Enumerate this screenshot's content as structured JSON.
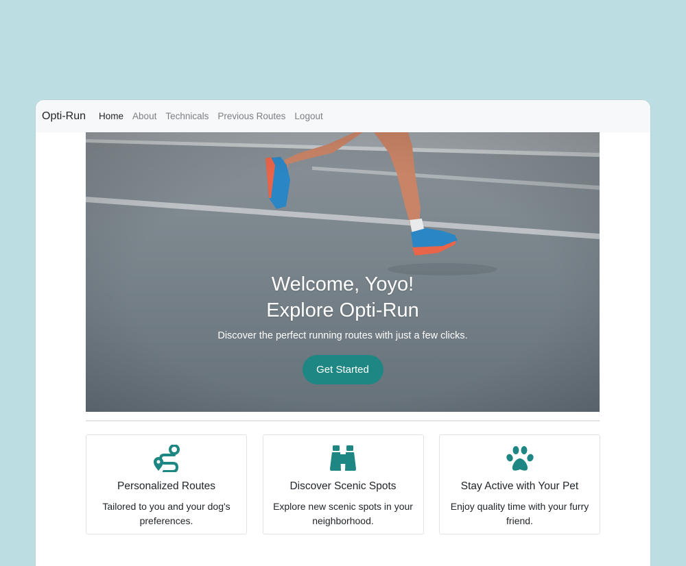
{
  "nav": {
    "brand": "Opti-Run",
    "links": [
      {
        "label": "Home",
        "active": true
      },
      {
        "label": "About",
        "active": false
      },
      {
        "label": "Technicals",
        "active": false
      },
      {
        "label": "Previous Routes",
        "active": false
      },
      {
        "label": "Logout",
        "active": false
      }
    ]
  },
  "hero": {
    "title_line1": "Welcome, Yoyo!",
    "title_line2": "Explore Opti-Run",
    "subtitle": "Discover the perfect running routes with just a few clicks.",
    "cta_label": "Get Started"
  },
  "features": [
    {
      "icon": "route-icon",
      "title": "Personalized Routes",
      "description": "Tailored to you and your dog's preferences."
    },
    {
      "icon": "binoculars-icon",
      "title": "Discover Scenic Spots",
      "description": "Explore new scenic spots in your neighborhood."
    },
    {
      "icon": "paw-icon",
      "title": "Stay Active with Your Pet",
      "description": "Enjoy quality time with your furry friend."
    }
  ],
  "colors": {
    "page_background": "#bcdde2",
    "accent": "#1f8783",
    "navbar_background": "#f7f8f9"
  }
}
